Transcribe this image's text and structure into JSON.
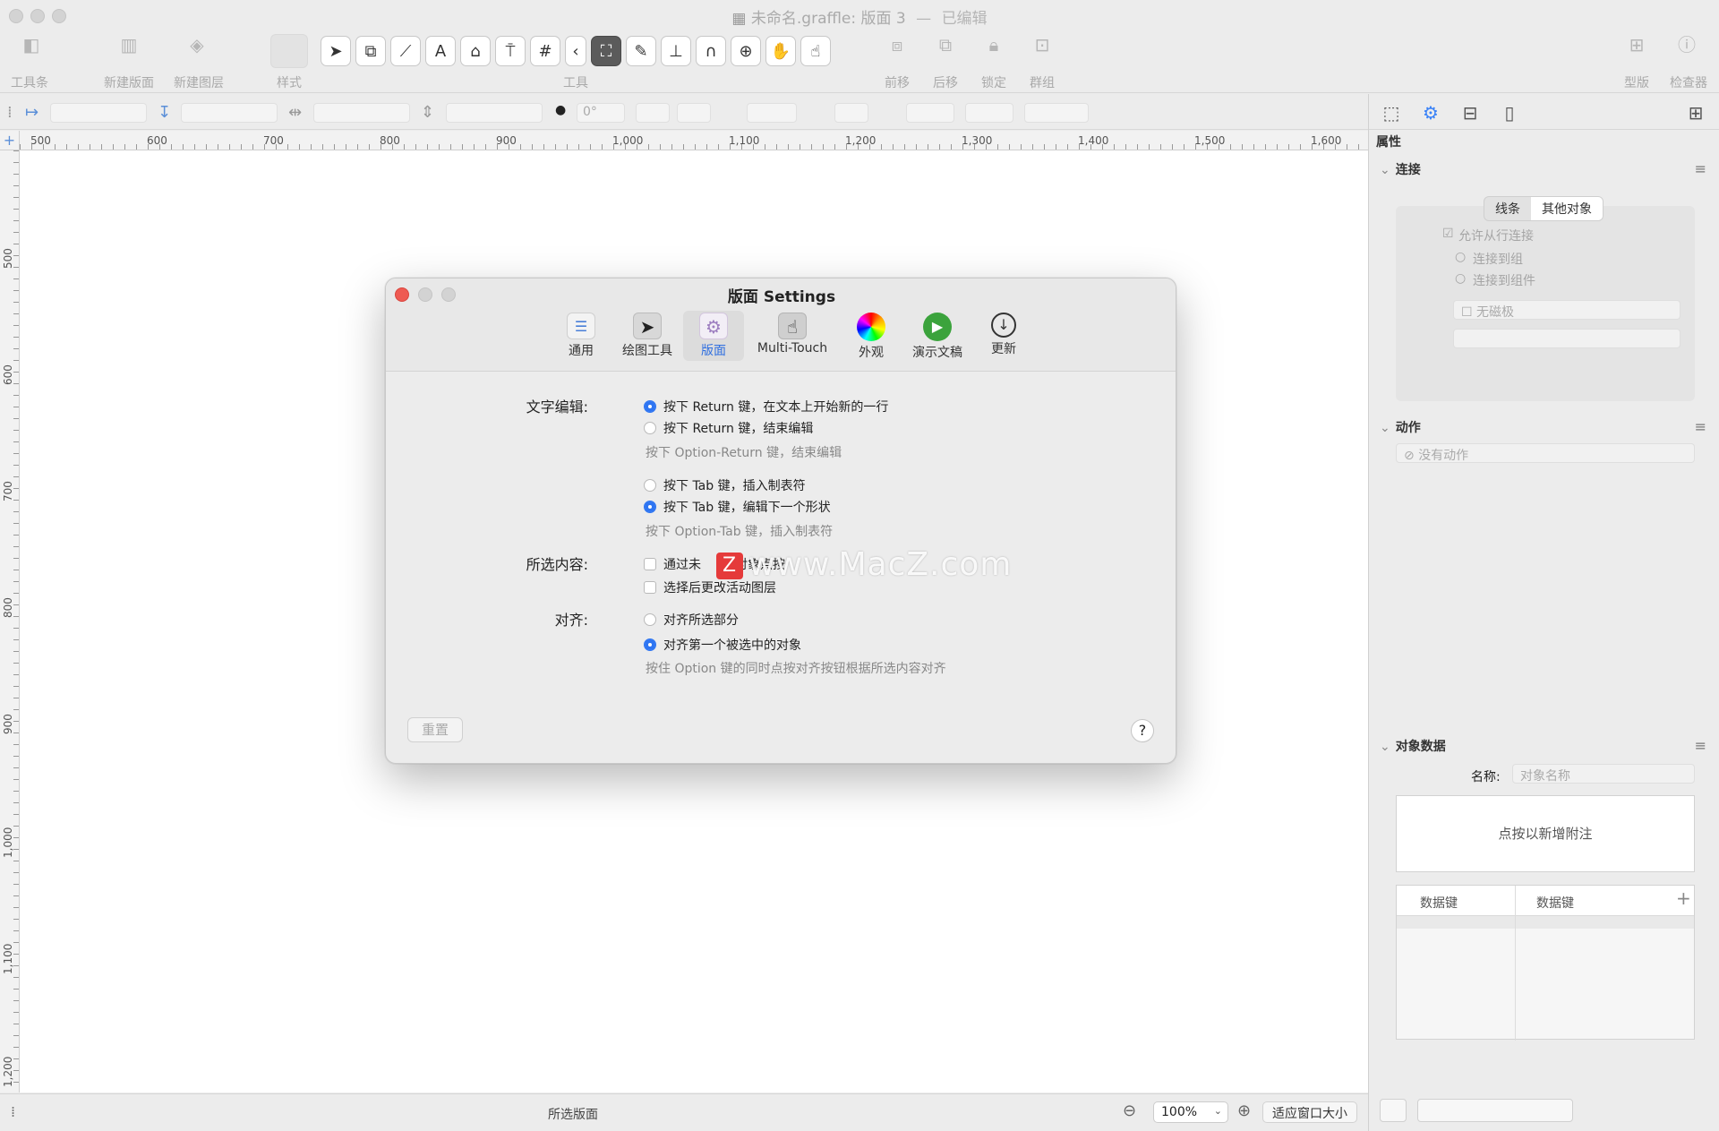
{
  "window": {
    "title": "未命名.graffle: 版面 3",
    "title_sep": "—",
    "title_status": "已编辑"
  },
  "toolbar": {
    "left": [
      "工具条",
      "新建版面",
      "新建图层",
      "样式"
    ],
    "tools_label": "工具",
    "right_group": [
      "前移",
      "后移",
      "锁定",
      "群组"
    ],
    "far_right": [
      "型版",
      "检查器"
    ]
  },
  "formatbar": {
    "rotation": "0°"
  },
  "ruler": {
    "top_ticks": [
      "500",
      "600",
      "700",
      "800",
      "900",
      "1,000",
      "1,100",
      "1,200",
      "1,300",
      "1,400",
      "1,500",
      "1,600"
    ],
    "left_ticks": [
      "500",
      "600",
      "700",
      "800",
      "900",
      "1,000",
      "1,100",
      "1,200"
    ]
  },
  "statusbar": {
    "text": "所选版面",
    "zoom": "100%",
    "fit_label": "适应窗口大小"
  },
  "inspector": {
    "header": "属性",
    "connection": {
      "title": "连接",
      "seg_lines": "线条",
      "seg_other": "其他对象",
      "allow_line": "允许从行连接",
      "to_group": "连接到组",
      "to_component": "连接到组件",
      "magnet": "无磁极"
    },
    "actions": {
      "title": "动作",
      "value": "没有动作"
    },
    "object_data": {
      "title": "对象数据",
      "name_label": "名称:",
      "name_placeholder": "对象名称",
      "note": "点按以新增附注",
      "col1": "数据键",
      "col2": "数据键",
      "add": "+"
    }
  },
  "dialog": {
    "title": "版面 Settings",
    "tabs": [
      {
        "label": "通用"
      },
      {
        "label": "绘图工具"
      },
      {
        "label": "版面"
      },
      {
        "label": "Multi-Touch"
      },
      {
        "label": "外观"
      },
      {
        "label": "演示文稿"
      },
      {
        "label": "更新"
      }
    ],
    "text_editing": {
      "label": "文字编辑:",
      "opt_return_newline": "按下 Return 键，在文本上开始新的一行",
      "opt_return_end": "按下 Return 键，结束编辑",
      "hint_option_return": "按下 Option-Return 键，结束编辑",
      "opt_tab_insert": "按下 Tab 键，插入制表符",
      "opt_tab_next": "按下 Tab 键，编辑下一个形状",
      "hint_option_tab": "按下 Option-Tab 键，插入制表符"
    },
    "selection": {
      "label": "所选内容:",
      "opt_unlocked": "通过未",
      "opt_unlocked_tail": "对象点按",
      "opt_change_layer": "选择后更改活动图层"
    },
    "align": {
      "label": "对齐:",
      "opt_selection": "对齐所选部分",
      "opt_first": "对齐第一个被选中的对象",
      "hint": "按住 Option 键的同时点按对齐按钮根据所选内容对齐"
    },
    "reset": "重置",
    "help": "?"
  },
  "watermark": {
    "text": "www.MacZ.com"
  }
}
